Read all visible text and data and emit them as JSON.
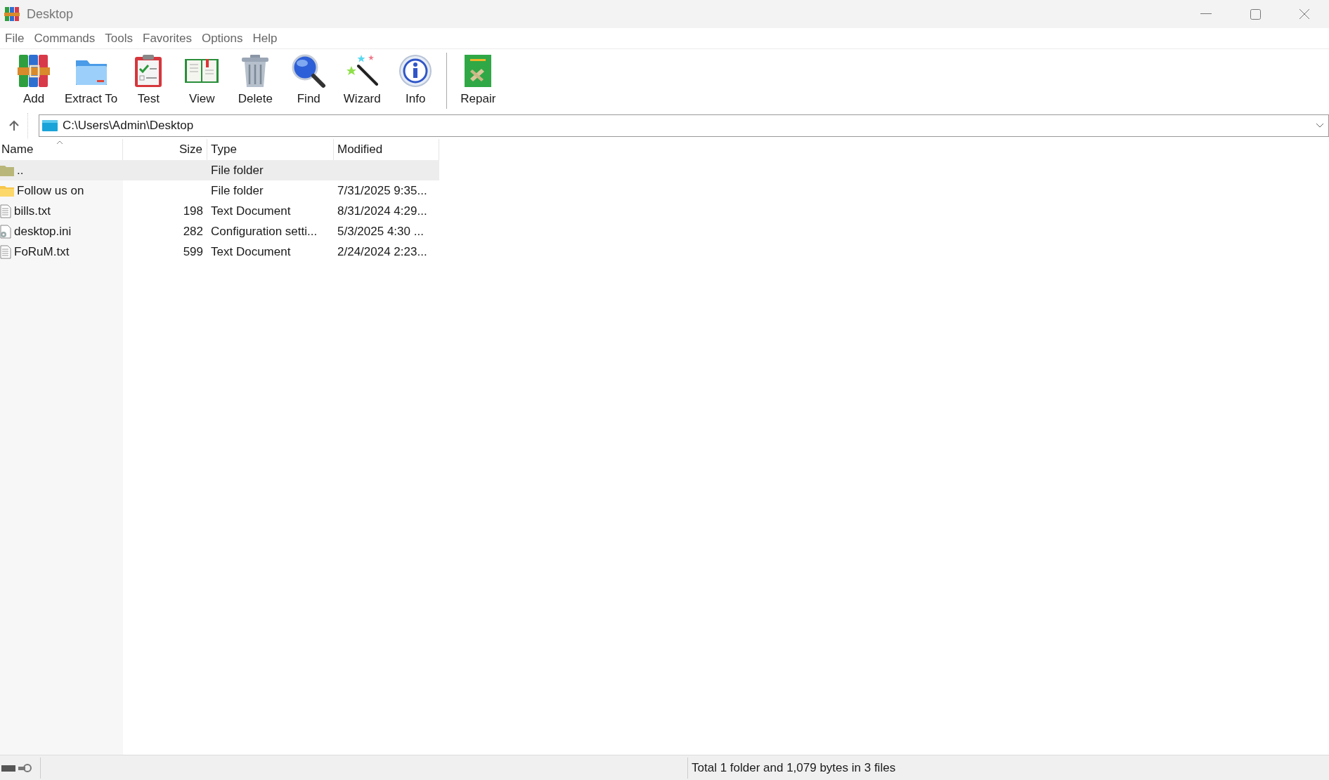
{
  "window": {
    "title": "Desktop"
  },
  "menu": [
    "File",
    "Commands",
    "Tools",
    "Favorites",
    "Options",
    "Help"
  ],
  "toolbar": [
    {
      "label": "Add",
      "kind": "add"
    },
    {
      "label": "Extract To",
      "kind": "extract"
    },
    {
      "label": "Test",
      "kind": "test"
    },
    {
      "label": "View",
      "kind": "view"
    },
    {
      "label": "Delete",
      "kind": "delete"
    },
    {
      "label": "Find",
      "kind": "find"
    },
    {
      "label": "Wizard",
      "kind": "wizard"
    },
    {
      "label": "Info",
      "kind": "info"
    },
    {
      "label": "Repair",
      "kind": "repair"
    }
  ],
  "address": {
    "path": "C:\\Users\\Admin\\Desktop"
  },
  "table": {
    "columns": [
      "Name",
      "Size",
      "Type",
      "Modified"
    ],
    "rows": [
      {
        "kind": "parent",
        "name": "..",
        "size": "",
        "type": "File folder",
        "modified": "",
        "selected": true
      },
      {
        "kind": "folder",
        "name": "Follow us on",
        "size": "",
        "type": "File folder",
        "modified": "7/31/2025 9:35...",
        "selected": false
      },
      {
        "kind": "text",
        "name": "bills.txt",
        "size": "198",
        "type": "Text Document",
        "modified": "8/31/2024 4:29...",
        "selected": false
      },
      {
        "kind": "config",
        "name": "desktop.ini",
        "size": "282",
        "type": "Configuration setti...",
        "modified": "5/3/2025 4:30 ...",
        "selected": false
      },
      {
        "kind": "text",
        "name": "FoRuM.txt",
        "size": "599",
        "type": "Text Document",
        "modified": "2/24/2024 2:23...",
        "selected": false
      }
    ]
  },
  "status_bar": {
    "text": "Total 1 folder and 1,079 bytes in 3 files"
  }
}
